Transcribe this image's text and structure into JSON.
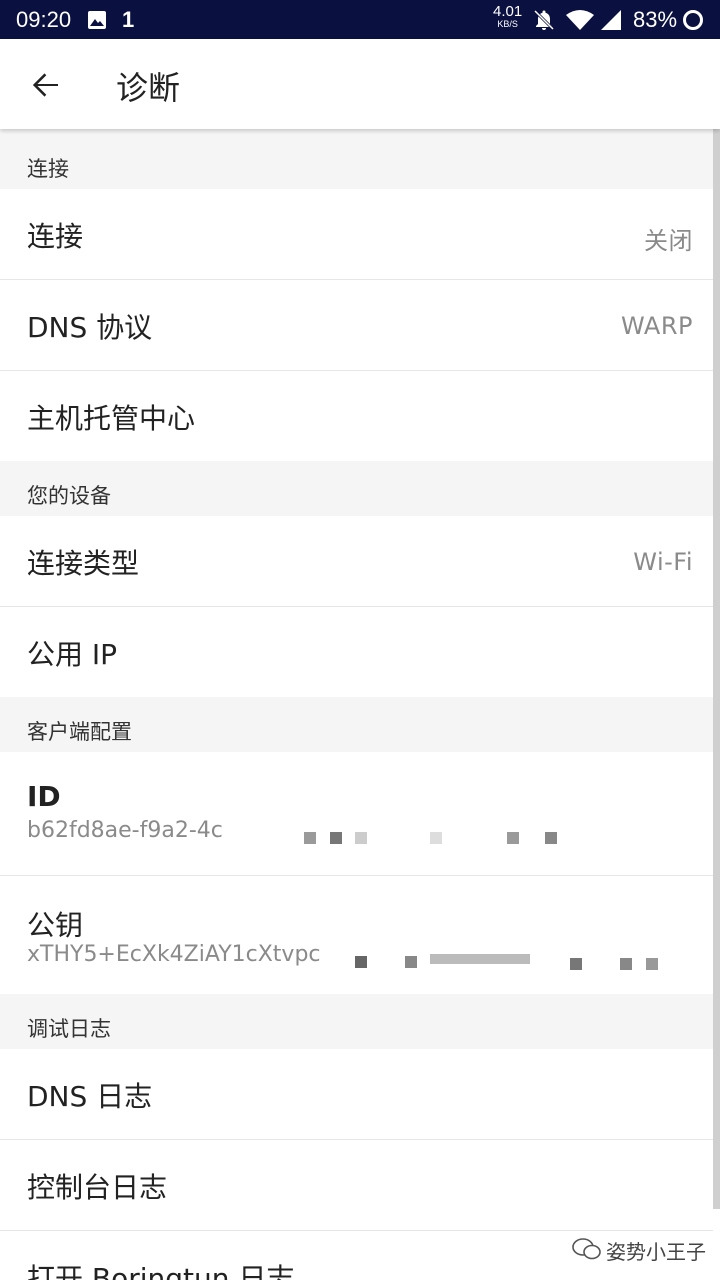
{
  "status_bar": {
    "time": "09:20",
    "sim": "1",
    "speed_value": "4.01",
    "speed_unit": "KB/S",
    "battery": "83%"
  },
  "header": {
    "title": "诊断"
  },
  "sections": {
    "connection": {
      "title": "连接",
      "connection_label": "连接",
      "connection_value": "关闭",
      "dns_label": "DNS 协议",
      "dns_value": "WARP",
      "hosting_label": "主机托管中心"
    },
    "device": {
      "title": "您的设备",
      "type_label": "连接类型",
      "type_value": "Wi-Fi",
      "ip_label": "公用 IP"
    },
    "client": {
      "title": "客户端配置",
      "id_label": "ID",
      "id_value": "b62fd8ae-f9a2-4c",
      "key_label": "公钥",
      "key_value": "xTHY5+EcXk4ZiAY1cXtvpc"
    },
    "debug": {
      "title": "调试日志",
      "dns_log": "DNS 日志",
      "console_log": "控制台日志",
      "boringtun_log": "打开 Boringtun 日志"
    }
  },
  "watermark": "姿势小王子"
}
